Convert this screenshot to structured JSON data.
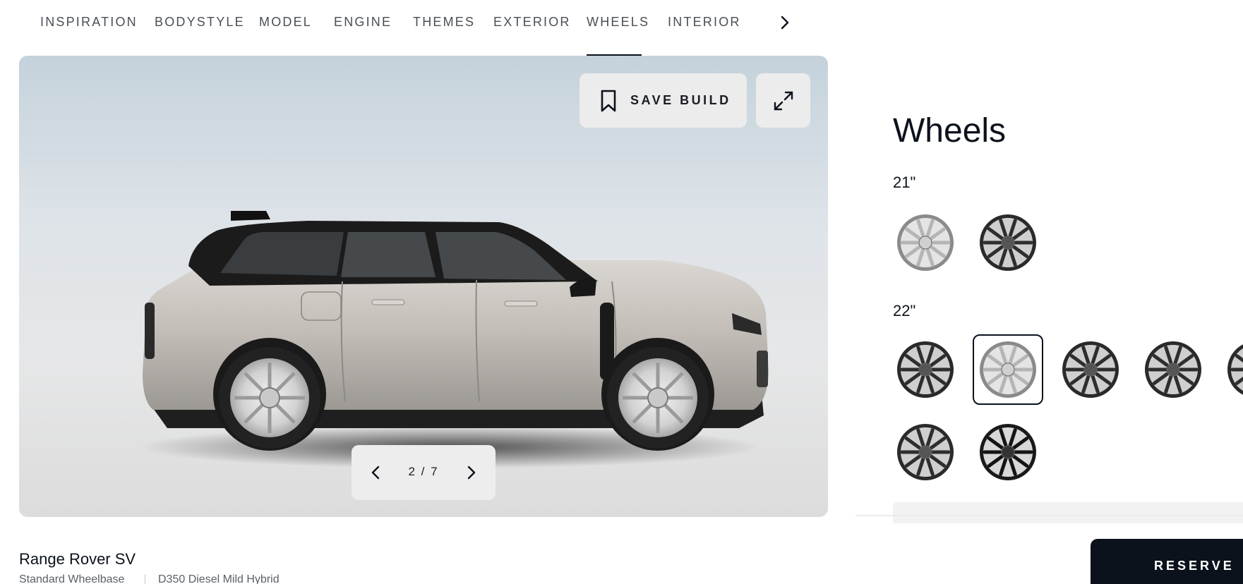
{
  "nav": {
    "tabs": [
      {
        "label": "INSPIRATION"
      },
      {
        "label": "BODYSTYLE"
      },
      {
        "label": "MODEL"
      },
      {
        "label": "ENGINE"
      },
      {
        "label": "THEMES"
      },
      {
        "label": "EXTERIOR"
      },
      {
        "label": "WHEELS"
      },
      {
        "label": "INTERIOR"
      }
    ],
    "active_tab": "WHEELS",
    "next_icon": "chevron-right-icon"
  },
  "viewer": {
    "save_label": "SAVE BUILD",
    "save_icon": "bookmark-icon",
    "expand_icon": "expand-icon",
    "counter": "2 / 7",
    "prev_icon": "chevron-left-icon",
    "next_icon": "chevron-right-icon",
    "car_color": "#b9b4ae"
  },
  "wheels": {
    "title": "Wheels",
    "groups": [
      {
        "size": "21\"",
        "options": [
          {
            "style": "silver"
          },
          {
            "style": "dark"
          }
        ]
      },
      {
        "size": "22\"",
        "options": [
          {
            "style": "dark"
          },
          {
            "style": "silver",
            "selected": true
          },
          {
            "style": "dark"
          },
          {
            "style": "dark"
          },
          {
            "style": "dark"
          },
          {
            "style": "dark"
          },
          {
            "style": "black"
          }
        ]
      }
    ]
  },
  "footer": {
    "model": "Range Rover SV",
    "specs": [
      "Standard Wheelbase",
      "D350 Diesel Mild Hybrid"
    ],
    "reserve_label": "RESERVE"
  },
  "colors": {
    "accent": "#0c121c",
    "panel_bg": "#ececec"
  }
}
